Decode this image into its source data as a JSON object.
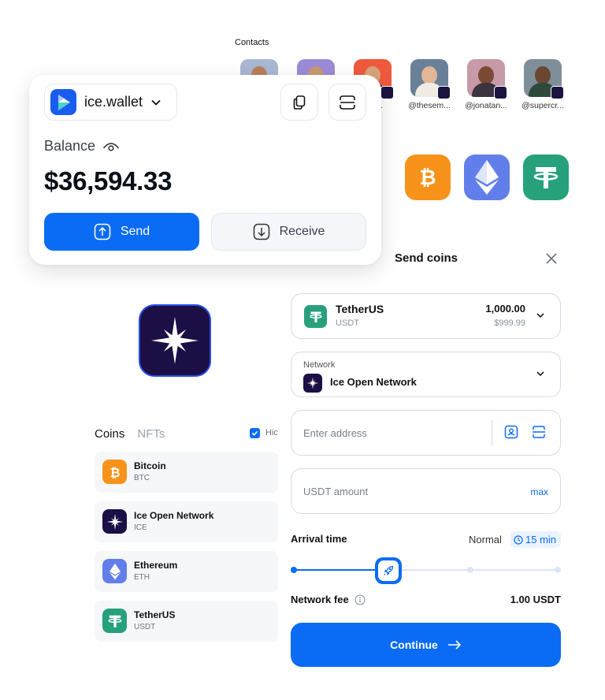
{
  "contacts": {
    "label": "Contacts",
    "items": [
      {
        "name": ""
      },
      {
        "name": ""
      },
      {
        "name": "...rx..."
      },
      {
        "name": "@thesem..."
      },
      {
        "name": "@jonatan..."
      },
      {
        "name": "@supercr..."
      }
    ]
  },
  "wallet": {
    "name": "ice.wallet",
    "balance_label": "Balance",
    "balance_value": "$36,594.33",
    "send_label": "Send",
    "receive_label": "Receive"
  },
  "coins_panel": {
    "tab_coins": "Coins",
    "tab_nfts": "NFTs",
    "hide_label": "Hic",
    "coins": [
      {
        "name": "Bitcoin",
        "symbol": "BTC",
        "color": "#f7931a"
      },
      {
        "name": "Ice Open Network",
        "symbol": "ICE",
        "color": "#1b0f45"
      },
      {
        "name": "Ethereum",
        "symbol": "ETH",
        "color": "#627eea"
      },
      {
        "name": "TetherUS",
        "symbol": "USDT",
        "color": "#26a17b"
      }
    ]
  },
  "send_coins": {
    "title": "Send coins",
    "token": {
      "name": "TetherUS",
      "symbol": "USDT",
      "amount": "1,000.00",
      "usd": "$999.99"
    },
    "network": {
      "label": "Network",
      "name": "Ice Open Network"
    },
    "address_placeholder": "Enter address",
    "amount_placeholder": "USDT amount",
    "max_label": "max",
    "arrival_label": "Arrival time",
    "arrival_speed": "Normal",
    "arrival_time": "15 min",
    "speed_level": 0.33,
    "fee_label": "Network fee",
    "fee_value": "1.00 USDT",
    "continue_label": "Continue"
  },
  "colors": {
    "accent": "#0a6cf5",
    "ice_dark": "#1b0f45"
  }
}
